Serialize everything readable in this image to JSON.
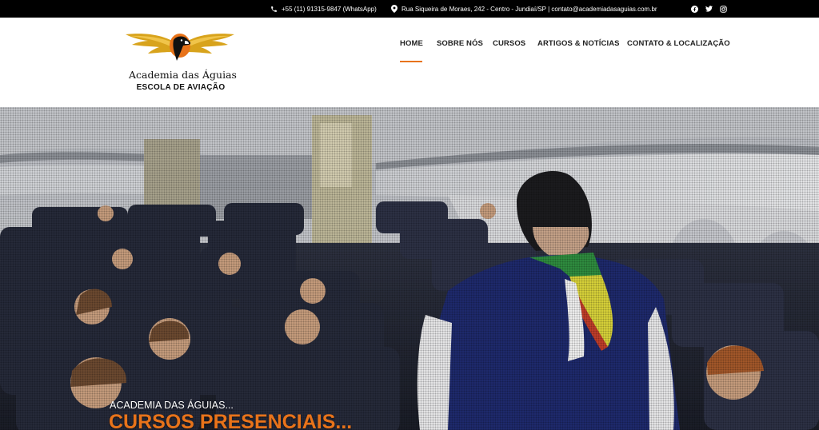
{
  "topbar": {
    "phone": "+55 (11) 91315-9847 (WhatsApp)",
    "address": "Rua Siqueira de Moraes, 242 - Centro - Jundiaí/SP | contato@academiadasaguias.com.br",
    "icons": [
      "phone-icon",
      "map-pin-icon",
      "facebook-icon",
      "twitter-icon",
      "instagram-icon"
    ]
  },
  "logo": {
    "name": "Academia das Águias",
    "subtitle": "ESCOLA DE AVIAÇÃO"
  },
  "nav": {
    "items": [
      {
        "label": "HOME",
        "active": true
      },
      {
        "label": "SOBRE NÓS"
      },
      {
        "label": "CURSOS"
      },
      {
        "label": "ARTIGOS & NOTÍCIAS"
      },
      {
        "label": "CONTATO & LOCALIZAÇÃO"
      }
    ]
  },
  "hero": {
    "kicker": "ACADEMIA DAS ÁGUIAS...",
    "headline": "CURSOS PRESENCIAIS..."
  },
  "colors": {
    "accent": "#e8731a",
    "topbar": "#000000",
    "logo_gold": "#d8a31c"
  }
}
